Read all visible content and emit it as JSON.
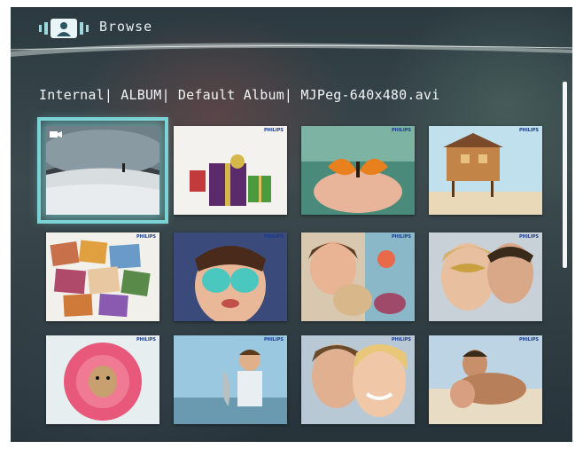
{
  "header": {
    "title": "Browse",
    "icon": "person-frame-icon"
  },
  "breadcrumb": "Internal| ALBUM| Default Album| MJPeg-640x480.avi",
  "thumbnails": [
    {
      "name": "thumb-snow-video",
      "brand": "",
      "selected": true,
      "video": true
    },
    {
      "name": "thumb-gift",
      "brand": "PHILIPS",
      "selected": false
    },
    {
      "name": "thumb-butterfly-hand",
      "brand": "PHILIPS",
      "selected": false
    },
    {
      "name": "thumb-beach-house",
      "brand": "PHILIPS",
      "selected": false
    },
    {
      "name": "thumb-collage",
      "brand": "PHILIPS",
      "selected": false
    },
    {
      "name": "thumb-child-paint",
      "brand": "PHILIPS",
      "selected": false
    },
    {
      "name": "thumb-woman-dog",
      "brand": "PHILIPS",
      "selected": false
    },
    {
      "name": "thumb-masquerade-couple",
      "brand": "PHILIPS",
      "selected": false
    },
    {
      "name": "thumb-flower-dog",
      "brand": "PHILIPS",
      "selected": false
    },
    {
      "name": "thumb-boy-fish",
      "brand": "PHILIPS",
      "selected": false
    },
    {
      "name": "thumb-smiling-couple",
      "brand": "PHILIPS",
      "selected": false
    },
    {
      "name": "thumb-beach-couple",
      "brand": "PHILIPS",
      "selected": false
    }
  ],
  "colors": {
    "accent": "#7bd3d6",
    "background": "#2f3d42"
  }
}
